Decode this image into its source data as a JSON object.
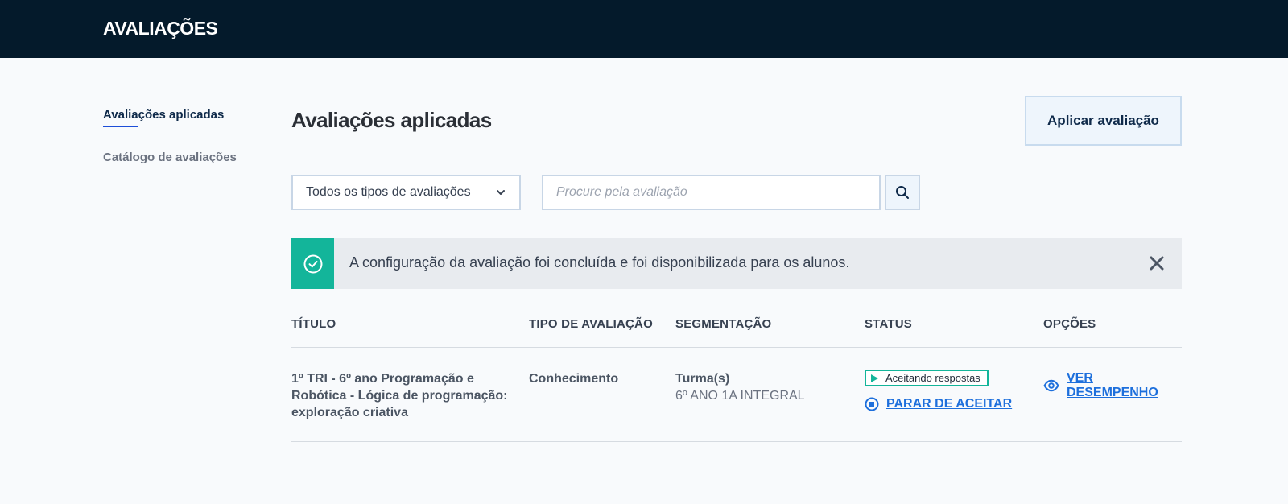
{
  "header": {
    "title": "AVALIAÇÕES"
  },
  "sidebar": {
    "items": [
      {
        "label": "Avaliações aplicadas"
      },
      {
        "label": "Catálogo de avaliações"
      }
    ]
  },
  "main": {
    "title": "Avaliações aplicadas",
    "apply_button": "Aplicar avaliação",
    "filter": {
      "selected": "Todos os tipos de avaliações"
    },
    "search": {
      "placeholder": "Procure pela avaliação",
      "value": ""
    },
    "alert": {
      "text": "A configuração da avaliação foi concluída e foi disponibilizada para os alunos."
    },
    "table": {
      "headers": [
        "TÍTULO",
        "TIPO DE AVALIAÇÃO",
        "SEGMENTAÇÃO",
        "STATUS",
        "OPÇÕES"
      ],
      "rows": [
        {
          "title": "1º TRI - 6º ano Programação e Robótica - Lógica de programação: exploração criativa",
          "type": "Conhecimento",
          "segmentation_type": "Turma(s)",
          "segmentation_class": "6º ANO 1A INTEGRAL",
          "status": "Aceitando respostas",
          "stop_action": "PARAR DE ACEITAR",
          "performance_action": "VER DESEMPENHO"
        }
      ]
    }
  },
  "colors": {
    "topbar": "#041a2b",
    "accent_teal": "#13b59a",
    "link_blue": "#1d6fdc",
    "background": "#f8fafc"
  },
  "icons": {
    "filter_dropdown": "chevron-down-icon",
    "search_button": "search-icon",
    "alert_success": "check-circle-icon",
    "alert_close": "close-icon",
    "status": "play-icon",
    "stop": "stop-circle-icon",
    "performance": "eye-icon"
  }
}
